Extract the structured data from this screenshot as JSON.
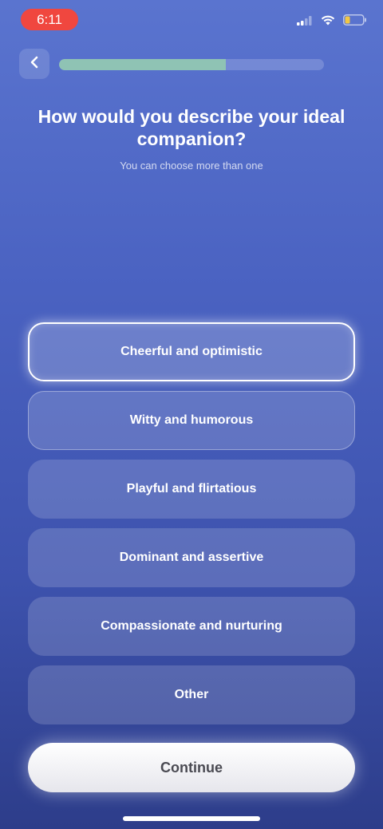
{
  "status_bar": {
    "time": "6:11",
    "icons": [
      "cellular-signal-icon",
      "wifi-icon",
      "battery-low-icon"
    ]
  },
  "header": {
    "back_icon": "chevron-left-icon",
    "progress": 0.63
  },
  "question": {
    "title": "How would you describe your ideal companion?",
    "hint": "You can choose more than one"
  },
  "options": [
    {
      "label": "Cheerful and optimistic",
      "selected": true
    },
    {
      "label": "Witty and humorous",
      "selected": false
    },
    {
      "label": "Playful and flirtatious",
      "selected": false
    },
    {
      "label": "Dominant and assertive",
      "selected": false
    },
    {
      "label": "Compassionate and nurturing",
      "selected": false
    },
    {
      "label": "Other",
      "selected": false
    }
  ],
  "footer": {
    "continue_label": "Continue"
  },
  "colors": {
    "time_pill": "#f0473f",
    "progress_fill": "#8fc3b4",
    "battery_fill": "#f2c744"
  }
}
